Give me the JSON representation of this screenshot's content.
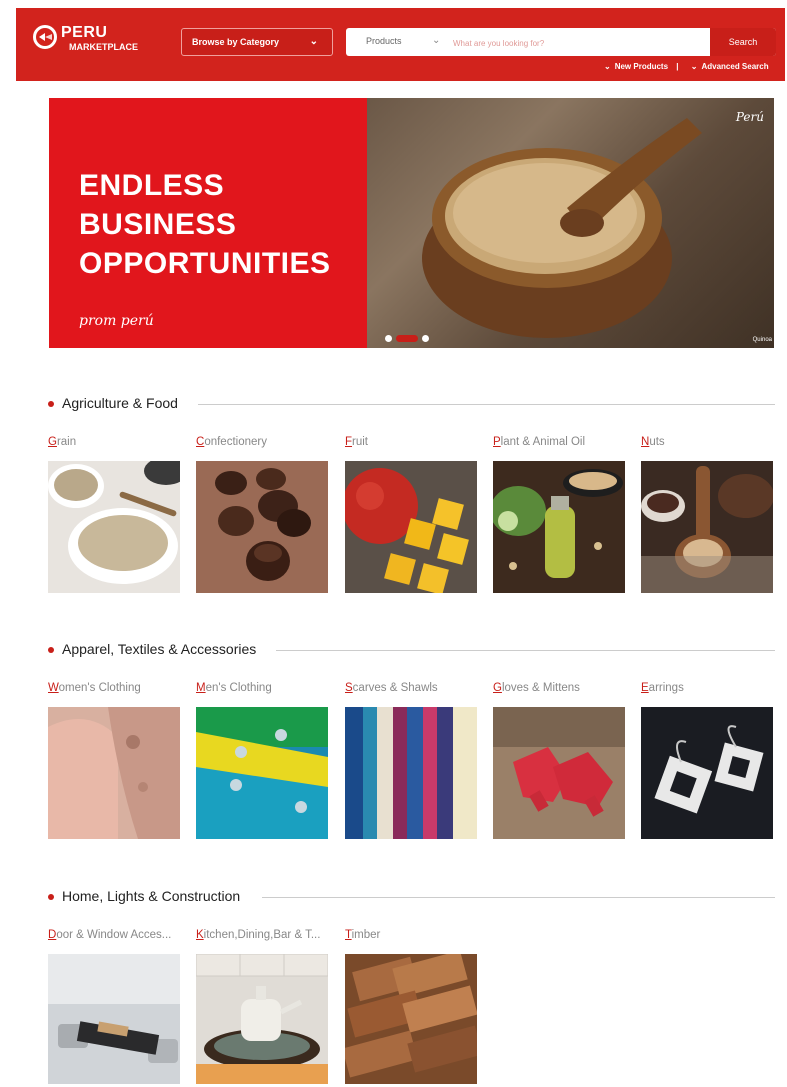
{
  "header": {
    "logo_line1": "PERU",
    "logo_line2": "MARKETPLACE",
    "browse_label": "Browse by Category",
    "search_scope": "Products",
    "search_placeholder": "What are you looking for?",
    "search_button": "Search",
    "link_new_products": "New Products",
    "link_advanced_search": "Advanced Search"
  },
  "hero": {
    "headline_line1": "ENDLESS",
    "headline_line2": "BUSINESS",
    "headline_line3": "OPPORTUNITIES",
    "brand": "prom perú",
    "mark": "Perú",
    "caption": "Quinoa",
    "slide_count": 3,
    "active_slide": 2
  },
  "sections": [
    {
      "title": "Agriculture & Food",
      "items": [
        {
          "label": "Grain",
          "image": "grain-photo"
        },
        {
          "label": "Confectionery",
          "image": "chocolates-photo"
        },
        {
          "label": "Fruit",
          "image": "mango-photo"
        },
        {
          "label": "Plant & Animal Oil",
          "image": "oil-photo"
        },
        {
          "label": "Nuts",
          "image": "nuts-photo"
        }
      ]
    },
    {
      "title": "Apparel, Textiles & Accessories",
      "items": [
        {
          "label": "Women's Clothing",
          "image": "sweater-photo"
        },
        {
          "label": "Men's Clothing",
          "image": "shirts-photo"
        },
        {
          "label": "Scarves & Shawls",
          "image": "scarves-photo"
        },
        {
          "label": "Gloves & Mittens",
          "image": "gloves-photo"
        },
        {
          "label": "Earrings",
          "image": "earrings-photo"
        }
      ]
    },
    {
      "title": "Home, Lights & Construction",
      "items": [
        {
          "label": "Door & Window Acces...",
          "image": "door-handle-photo"
        },
        {
          "label": "Kitchen,Dining,Bar & T...",
          "image": "teapot-photo"
        },
        {
          "label": "Timber",
          "image": "timber-photo"
        }
      ]
    }
  ],
  "colors": {
    "brand_red": "#d2231d",
    "accent_red": "#c81f19",
    "hero_red": "#e1161c",
    "label_gray": "#888888"
  }
}
